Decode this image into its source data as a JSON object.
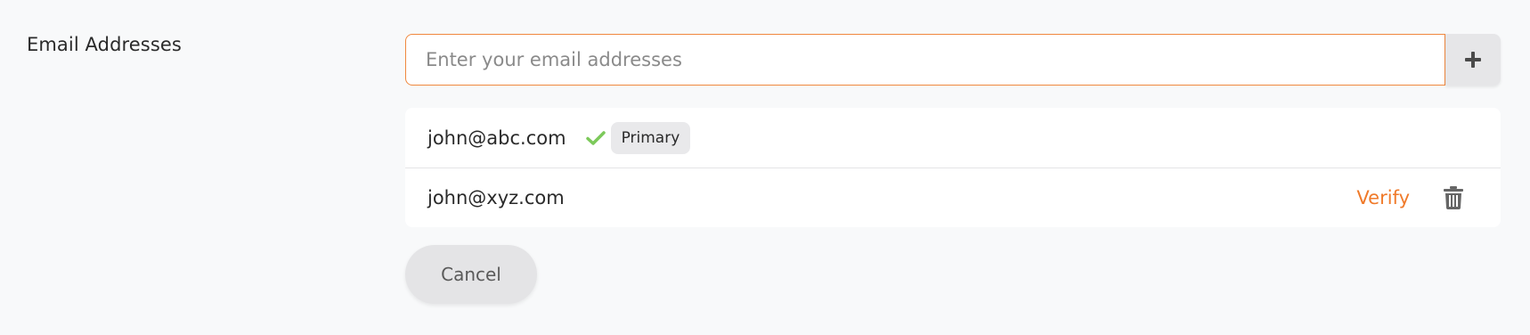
{
  "section": {
    "label": "Email Addresses"
  },
  "email_input": {
    "value": "",
    "placeholder": "Enter your email addresses"
  },
  "add_button": {
    "icon": "plus-icon"
  },
  "emails": [
    {
      "address": "john@abc.com",
      "verified": true,
      "badge": "Primary"
    },
    {
      "address": "john@xyz.com",
      "verified": false,
      "action_label": "Verify",
      "delete_icon": "trash-icon"
    }
  ],
  "cancel_button": {
    "label": "Cancel"
  },
  "colors": {
    "accent": "#f07a2a",
    "input_border": "#f0883e",
    "check": "#7cc95a",
    "background": "#f8f9fa"
  }
}
